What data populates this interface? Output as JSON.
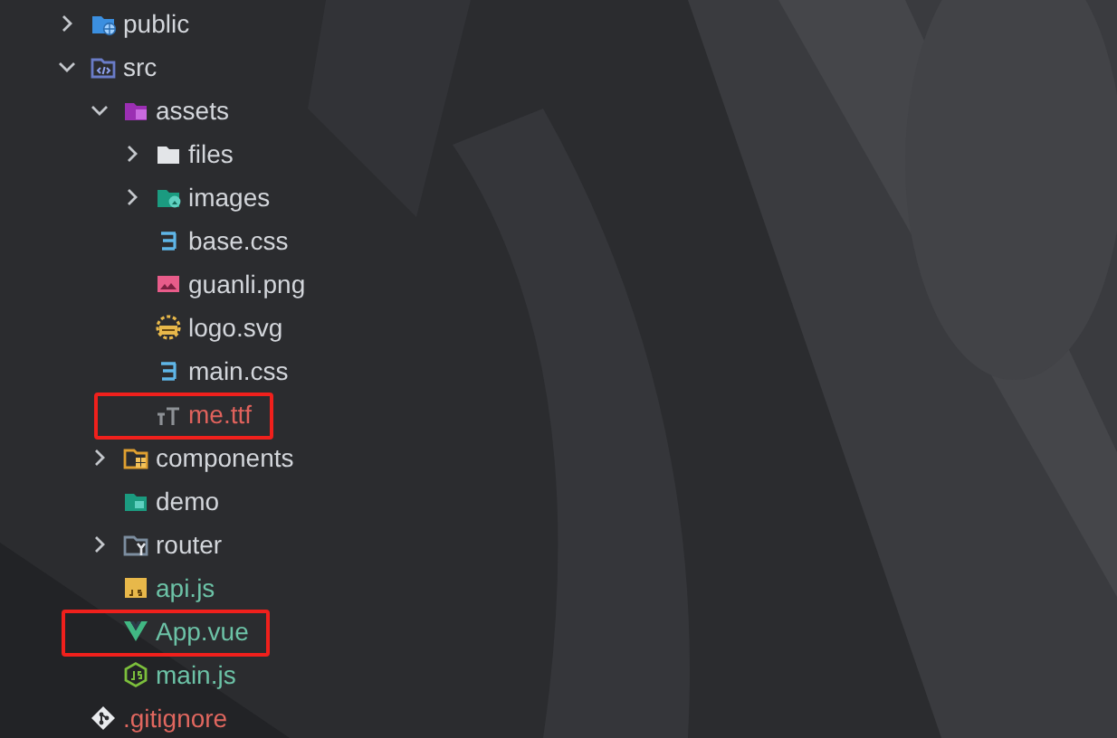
{
  "tree": [
    {
      "label": "public",
      "kind": "public-folder",
      "expanded": false,
      "highlighted": false,
      "color": "#d3d6db"
    },
    {
      "label": "src",
      "kind": "src-folder",
      "expanded": true,
      "highlighted": false,
      "color": "#d3d6db",
      "children": [
        {
          "label": "assets",
          "kind": "assets-folder",
          "expanded": true,
          "highlighted": false,
          "color": "#d3d6db",
          "children": [
            {
              "label": "files",
              "kind": "folder",
              "expanded": false,
              "highlighted": false,
              "color": "#d3d6db"
            },
            {
              "label": "images",
              "kind": "images-folder",
              "expanded": false,
              "highlighted": false,
              "color": "#d3d6db"
            },
            {
              "label": "base.css",
              "kind": "css-file",
              "highlighted": false,
              "color": "#d3d6db"
            },
            {
              "label": "guanli.png",
              "kind": "image-file",
              "highlighted": false,
              "color": "#d3d6db"
            },
            {
              "label": "logo.svg",
              "kind": "svg-file",
              "highlighted": false,
              "color": "#d3d6db"
            },
            {
              "label": "main.css",
              "kind": "css-file",
              "highlighted": false,
              "color": "#d3d6db"
            },
            {
              "label": "me.ttf",
              "kind": "font-file",
              "highlighted": true,
              "color": "#e0625c"
            }
          ]
        },
        {
          "label": "components",
          "kind": "components-folder",
          "expanded": false,
          "highlighted": false,
          "color": "#d3d6db"
        },
        {
          "label": "demo",
          "kind": "demo-folder",
          "highlighted": false,
          "color": "#d3d6db"
        },
        {
          "label": "router",
          "kind": "router-folder",
          "expanded": false,
          "highlighted": false,
          "color": "#d3d6db"
        },
        {
          "label": "api.js",
          "kind": "js-file",
          "highlighted": false,
          "color": "#6cc2a6"
        },
        {
          "label": "App.vue",
          "kind": "vue-file",
          "highlighted": true,
          "color": "#6cc2a6"
        },
        {
          "label": "main.js",
          "kind": "node-js-file",
          "highlighted": false,
          "color": "#6cc2a6"
        }
      ]
    },
    {
      "label": ".gitignore",
      "kind": "git-file",
      "highlighted": false,
      "color": "#e0675f"
    }
  ]
}
